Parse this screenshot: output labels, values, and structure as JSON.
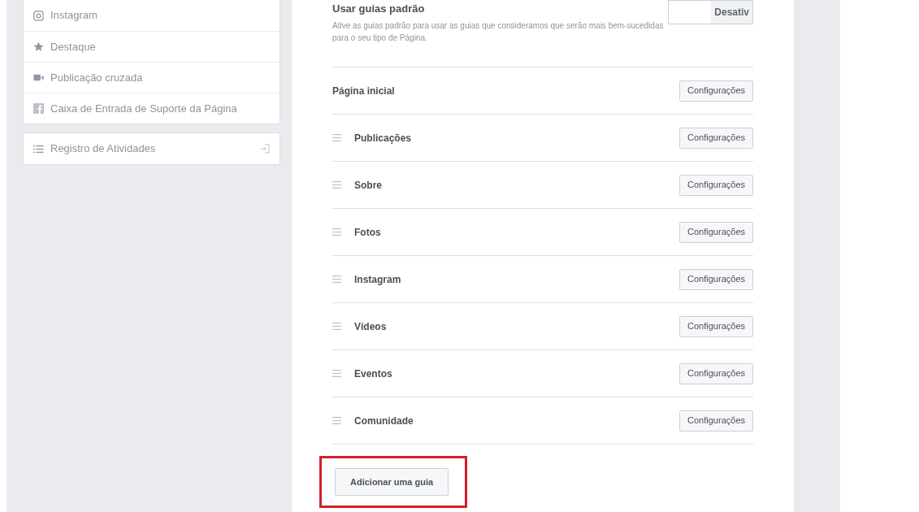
{
  "sidebar": {
    "groups": [
      [
        {
          "kind": "instagram",
          "label": "Instagram"
        },
        {
          "kind": "featured",
          "label": "Destaque"
        },
        {
          "kind": "crosspost",
          "label": "Publicação cruzada"
        },
        {
          "kind": "inbox",
          "label": "Caixa de Entrada de Suporte da Página"
        }
      ],
      [
        {
          "kind": "activity-log",
          "label": "Registro de Atividades"
        }
      ]
    ]
  },
  "default_tabs": {
    "title": "Usar guias padrão",
    "description": "Ative as guias padrão para usar as guias que consideramos que serão mais bem-sucedidas para o seu tipo de Página.",
    "toggle_label": "Desativ",
    "on": false
  },
  "tabs": [
    {
      "label": "Página inicial",
      "draggable": false,
      "button": "Configurações"
    },
    {
      "label": "Publicações",
      "draggable": true,
      "button": "Configurações"
    },
    {
      "label": "Sobre",
      "draggable": true,
      "button": "Configurações"
    },
    {
      "label": "Fotos",
      "draggable": true,
      "button": "Configurações"
    },
    {
      "label": "Instagram",
      "draggable": true,
      "button": "Configurações"
    },
    {
      "label": "Vídeos",
      "draggable": true,
      "button": "Configurações"
    },
    {
      "label": "Eventos",
      "draggable": true,
      "button": "Configurações"
    },
    {
      "label": "Comunidade",
      "draggable": true,
      "button": "Configurações"
    }
  ],
  "add_button": {
    "label": "Adicionar uma guia",
    "highlighted": true
  }
}
